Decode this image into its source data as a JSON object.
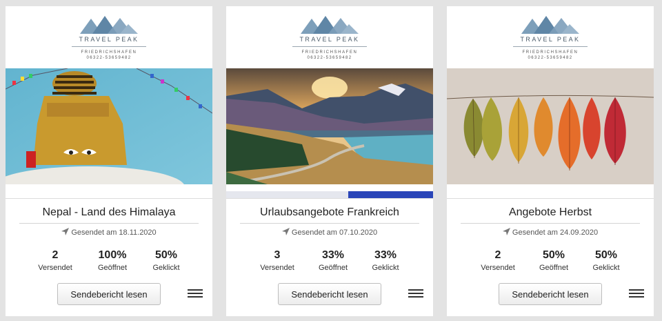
{
  "cards": [
    {
      "logo": {
        "brand": "TRAVEL PEAK",
        "city": "FRIEDRICHSHAFEN",
        "phone": "06322-53659482"
      },
      "title": "Nepal - Land des Himalaya",
      "sent": "Gesendet am 18.11.2020",
      "stats": [
        {
          "value": "2",
          "label": "Versendet"
        },
        {
          "value": "100%",
          "label": "Geöffnet"
        },
        {
          "value": "50%",
          "label": "Geklickt"
        }
      ],
      "button": "Sendebericht lesen",
      "image": "stupa-prayer-flags-photo",
      "progress": 0
    },
    {
      "logo": {
        "brand": "TRAVEL PEAK",
        "city": "FRIEDRICHSHAFEN",
        "phone": "06322-53659482"
      },
      "title": "Urlaubsangebote Frankreich",
      "sent": "Gesendet am 07.10.2020",
      "stats": [
        {
          "value": "3",
          "label": "Versendet"
        },
        {
          "value": "33%",
          "label": "Geöffnet"
        },
        {
          "value": "33%",
          "label": "Geklickt"
        }
      ],
      "button": "Sendebericht lesen",
      "image": "mountain-lake-road-photo",
      "progress": 0.41
    },
    {
      "logo": {
        "brand": "TRAVEL PEAK",
        "city": "FRIEDRICHSHAFEN",
        "phone": "06322-53659482"
      },
      "title": "Angebote Herbst",
      "sent": "Gesendet am 24.09.2020",
      "stats": [
        {
          "value": "2",
          "label": "Versendet"
        },
        {
          "value": "50%",
          "label": "Geöffnet"
        },
        {
          "value": "50%",
          "label": "Geklickt"
        }
      ],
      "button": "Sendebericht lesen",
      "image": "autumn-leaves-line-photo",
      "progress": 0
    }
  ],
  "icons": {
    "sent": "paper-plane-icon",
    "menu": "hamburger-menu-icon",
    "logo": "mountain-logo-icon"
  },
  "colors": {
    "progress": "#2a45b8",
    "logo": "#6f93b0",
    "background": "#e3e3e3"
  }
}
